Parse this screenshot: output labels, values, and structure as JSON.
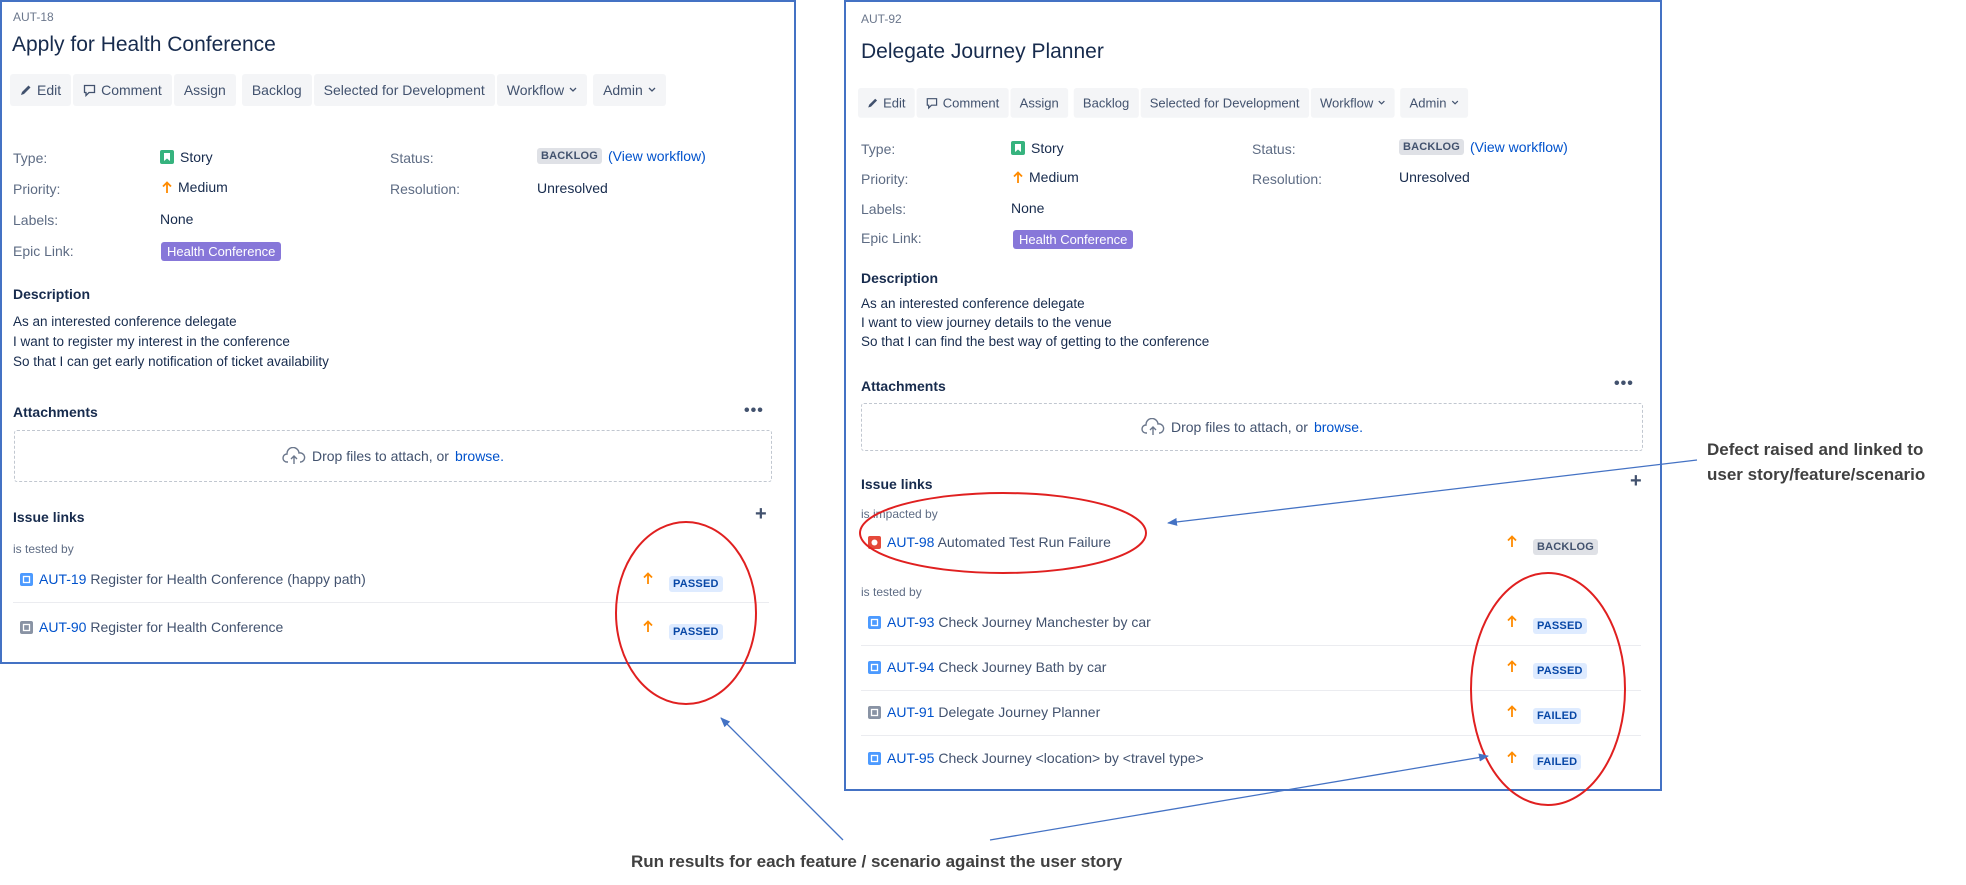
{
  "left": {
    "key": "AUT-18",
    "title": "Apply for Health Conference",
    "toolbar": {
      "edit": "Edit",
      "comment": "Comment",
      "assign": "Assign",
      "backlog": "Backlog",
      "selected": "Selected for Development",
      "workflow": "Workflow",
      "admin": "Admin"
    },
    "fields": {
      "type_label": "Type:",
      "type_value": "Story",
      "priority_label": "Priority:",
      "priority_value": "Medium",
      "labels_label": "Labels:",
      "labels_value": "None",
      "epic_label": "Epic Link:",
      "epic_value": "Health Conference",
      "status_label": "Status:",
      "status_value": "BACKLOG",
      "view_workflow": "(View workflow)",
      "resolution_label": "Resolution:",
      "resolution_value": "Unresolved"
    },
    "description": {
      "heading": "Description",
      "lines": [
        "As an interested conference delegate",
        "I want to register my interest in the conference",
        "So that I can get early notification of ticket availability"
      ]
    },
    "attachments": {
      "heading": "Attachments",
      "drop_text": "Drop files to attach, or",
      "browse": "browse."
    },
    "issue_links": {
      "heading": "Issue links",
      "groups": [
        {
          "label": "is tested by",
          "items": [
            {
              "key": "AUT-19",
              "summary": "Register for Health Conference (happy path)",
              "status": "PASSED"
            },
            {
              "key": "AUT-90",
              "summary": "Register for Health Conference",
              "status": "PASSED"
            }
          ]
        }
      ]
    }
  },
  "right": {
    "key": "AUT-92",
    "title": "Delegate Journey Planner",
    "toolbar": {
      "edit": "Edit",
      "comment": "Comment",
      "assign": "Assign",
      "backlog": "Backlog",
      "selected": "Selected for Development",
      "workflow": "Workflow",
      "admin": "Admin"
    },
    "fields": {
      "type_label": "Type:",
      "type_value": "Story",
      "priority_label": "Priority:",
      "priority_value": "Medium",
      "labels_label": "Labels:",
      "labels_value": "None",
      "epic_label": "Epic Link:",
      "epic_value": "Health Conference",
      "status_label": "Status:",
      "status_value": "BACKLOG",
      "view_workflow": "(View workflow)",
      "resolution_label": "Resolution:",
      "resolution_value": "Unresolved"
    },
    "description": {
      "heading": "Description",
      "lines": [
        "As an interested conference delegate",
        "I want to view journey details to the venue",
        "So that I can find the best way of getting to the conference"
      ]
    },
    "attachments": {
      "heading": "Attachments",
      "drop_text": "Drop files to attach, or",
      "browse": "browse."
    },
    "issue_links": {
      "heading": "Issue links",
      "groups": [
        {
          "label": "is impacted by",
          "items": [
            {
              "key": "AUT-98",
              "summary": "Automated Test Run Failure",
              "status": "BACKLOG"
            }
          ]
        },
        {
          "label": "is tested by",
          "items": [
            {
              "key": "AUT-93",
              "summary": "Check Journey Manchester by car",
              "status": "PASSED"
            },
            {
              "key": "AUT-94",
              "summary": "Check Journey Bath by car",
              "status": "PASSED"
            },
            {
              "key": "AUT-91",
              "summary": "Delegate Journey Planner",
              "status": "FAILED"
            },
            {
              "key": "AUT-95",
              "summary": "Check Journey <location> by <travel type>",
              "status": "FAILED"
            }
          ]
        }
      ]
    }
  },
  "annotations": {
    "defect_line1": "Defect raised and linked to",
    "defect_line2": "user story/feature/scenario",
    "run_results": "Run results for each feature / scenario against the user story"
  },
  "colors": {
    "panel_border": "#4472c4",
    "link": "#0052cc",
    "epic": "#8777d9",
    "story_icon": "#36b37e",
    "bug_icon": "#e5493a",
    "test_icon": "#4c9aff",
    "priority_medium": "#ff8b00",
    "annotation_circle": "#e02020",
    "annotation_arrow": "#4472c4"
  },
  "icons": [
    "pencil-icon",
    "comment-icon",
    "chevron-down-icon",
    "story-icon",
    "priority-medium-icon",
    "upload-cloud-icon",
    "more-icon",
    "add-icon",
    "test-icon",
    "precondition-icon",
    "bug-icon"
  ]
}
